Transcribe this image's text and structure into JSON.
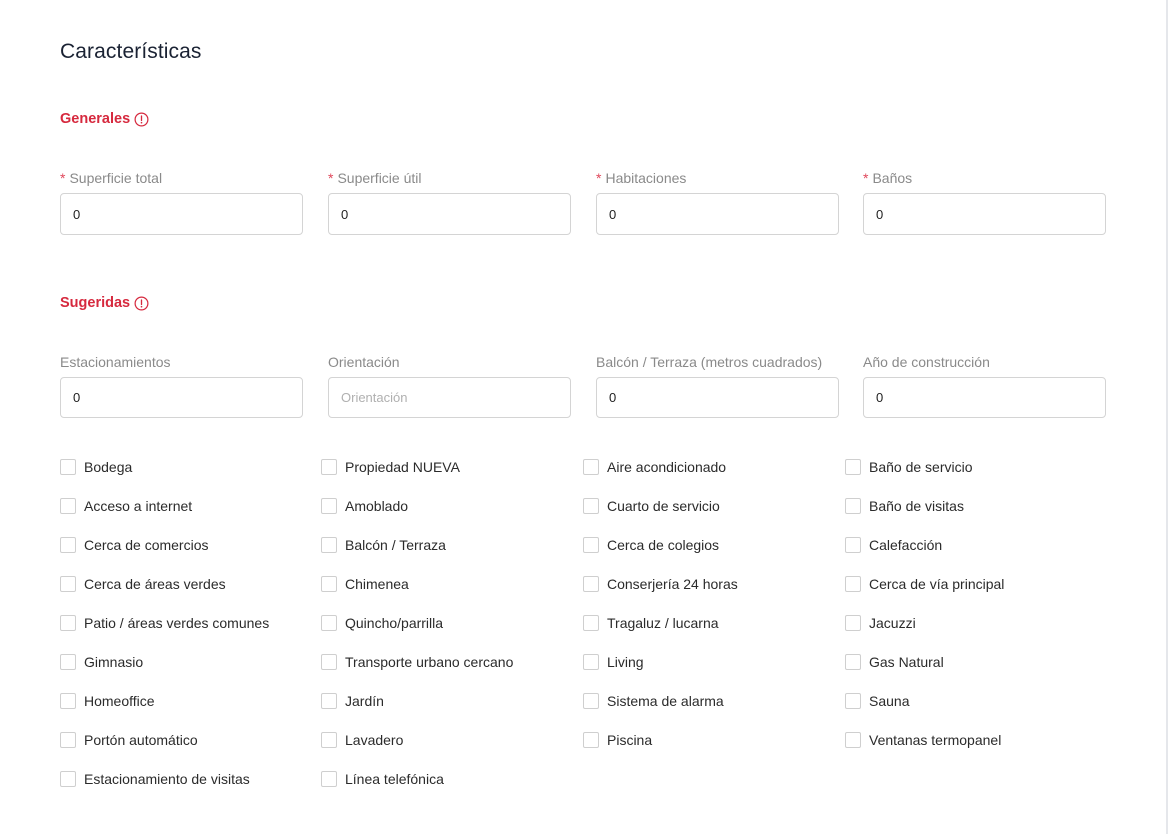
{
  "title": "Características",
  "sections": {
    "generales": {
      "label": "Generales"
    },
    "sugeridas": {
      "label": "Sugeridas"
    }
  },
  "generales_fields": [
    {
      "label": "Superficie total",
      "required": true,
      "value": "0"
    },
    {
      "label": "Superficie útil",
      "required": true,
      "value": "0"
    },
    {
      "label": "Habitaciones",
      "required": true,
      "value": "0"
    },
    {
      "label": "Baños",
      "required": true,
      "value": "0"
    }
  ],
  "sugeridas_fields": [
    {
      "label": "Estacionamientos",
      "value": "0",
      "placeholder": ""
    },
    {
      "label": "Orientación",
      "value": "",
      "placeholder": "Orientación"
    },
    {
      "label": "Balcón / Terraza (metros cuadrados)",
      "value": "0",
      "placeholder": ""
    },
    {
      "label": "Año de construcción",
      "value": "0",
      "placeholder": ""
    }
  ],
  "required_marker": "*",
  "checkbox_columns": [
    [
      "Bodega",
      "Acceso a internet",
      "Cerca de comercios",
      "Cerca de áreas verdes",
      "Patio / áreas verdes comunes",
      "Gimnasio",
      "Homeoffice",
      "Portón automático",
      "Estacionamiento de visitas"
    ],
    [
      "Propiedad NUEVA",
      "Amoblado",
      "Balcón / Terraza",
      "Chimenea",
      "Quincho/parrilla",
      "Transporte urbano cercano",
      "Jardín",
      "Lavadero",
      "Línea telefónica"
    ],
    [
      "Aire acondicionado",
      "Cuarto de servicio",
      "Cerca de colegios",
      "Conserjería 24 horas",
      "Tragaluz / lucarna",
      "Living",
      "Sistema de alarma",
      "Piscina"
    ],
    [
      "Baño de servicio",
      "Baño de visitas",
      "Calefacción",
      "Cerca de vía principal",
      "Jacuzzi",
      "Gas Natural",
      "Sauna",
      "Ventanas termopanel"
    ]
  ],
  "colors": {
    "accent": "#d6293e",
    "required": "#e0475b",
    "title": "#1a2233",
    "label": "#8a8a8a",
    "border": "#d4d4d4"
  }
}
